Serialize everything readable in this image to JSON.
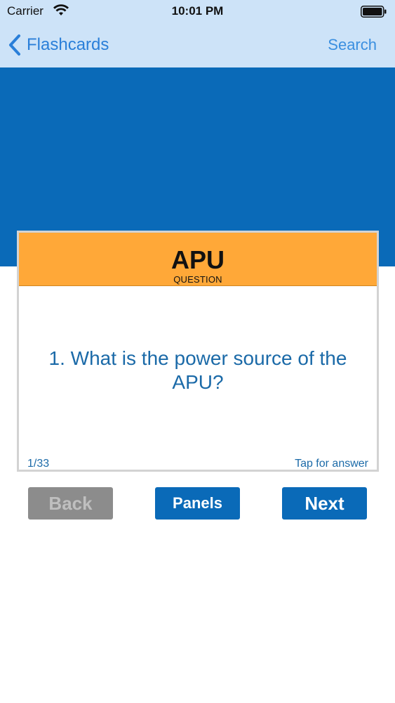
{
  "status_bar": {
    "carrier": "Carrier",
    "time": "10:01 PM",
    "wifi_icon": "wifi-icon",
    "battery_icon": "battery-icon"
  },
  "nav": {
    "back_label": "Flashcards",
    "back_icon": "chevron-left-icon",
    "search_label": "Search"
  },
  "card": {
    "title": "APU",
    "subtitle": "QUESTION",
    "question": "1. What is the power source of the APU?",
    "counter": "1/33",
    "hint": "Tap for answer"
  },
  "buttons": {
    "back": "Back",
    "panels": "Panels",
    "next": "Next"
  },
  "colors": {
    "nav_background": "#cde3f8",
    "accent_blue": "#0a6ab8",
    "card_header": "#ffa838",
    "disabled_gray": "#8c8c8c",
    "link_blue": "#2a7fd9"
  }
}
